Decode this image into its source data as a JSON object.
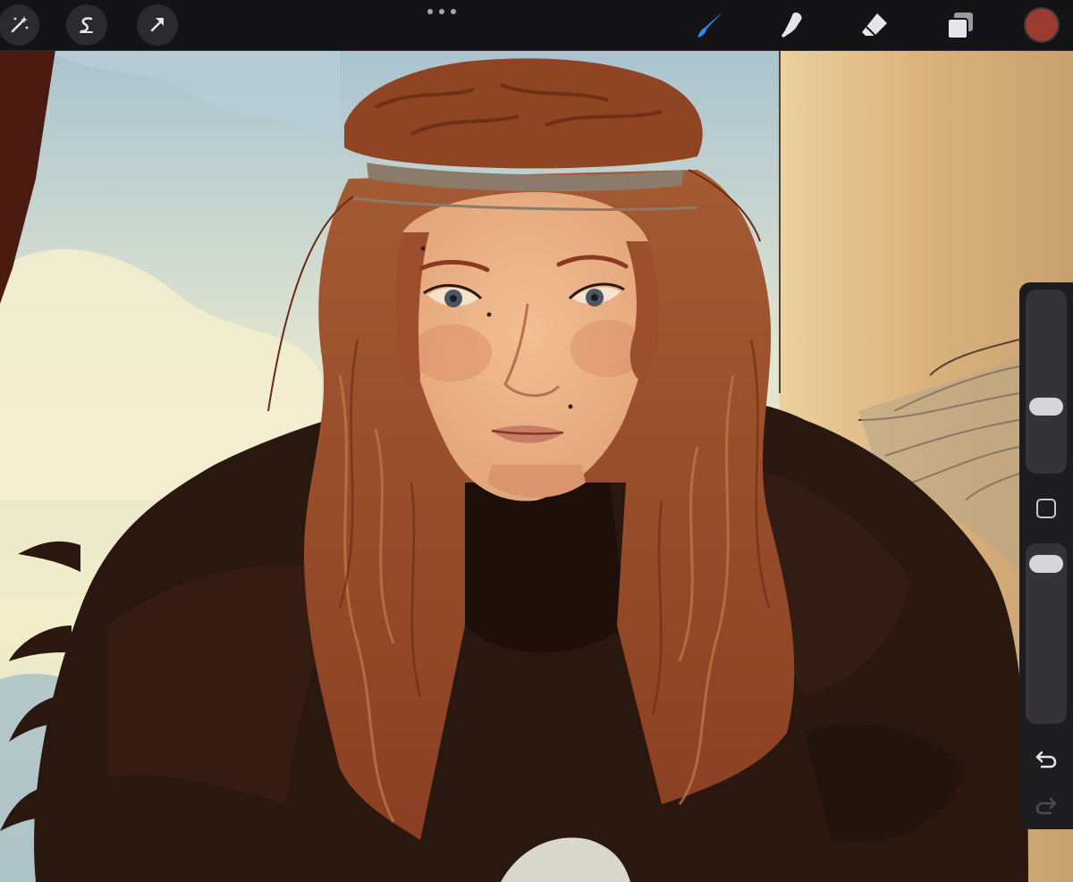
{
  "app": "Procreate",
  "toolbar": {
    "left_tools": [
      {
        "name": "adjustments",
        "icon": "magic-wand-icon"
      },
      {
        "name": "selection",
        "icon": "selection-s-icon"
      },
      {
        "name": "transform",
        "icon": "arrow-cursor-icon"
      }
    ],
    "more_menu_icon": "ellipsis-icon",
    "right_tools": [
      {
        "name": "brush",
        "icon": "brush-icon",
        "active": true
      },
      {
        "name": "smudge",
        "icon": "smudge-finger-icon",
        "active": false
      },
      {
        "name": "eraser",
        "icon": "eraser-icon",
        "active": false
      },
      {
        "name": "layers",
        "icon": "layers-icon",
        "active": false
      }
    ],
    "current_color": "#9b3a2f"
  },
  "colors": {
    "active_tool": "#2f8cf5",
    "inactive_tool": "#e6e6e8",
    "toolbar_bg": "#141416"
  },
  "sidebar": {
    "brush_size_level": 0.34,
    "opacity_level": 0.95,
    "modify_icon": "square-modify-icon",
    "undo_icon": "undo-arrow-icon",
    "redo_icon": "redo-arrow-icon"
  },
  "canvas": {
    "artwork": "illustration-woman-red-hair-fur-cloak",
    "palette": {
      "sky": "#a9c3cf",
      "light": "#f2ecc8",
      "wall": "#d9b27e",
      "hair": "#9c4f2c",
      "skin": "#eab088",
      "fur": "#2a1710"
    }
  }
}
